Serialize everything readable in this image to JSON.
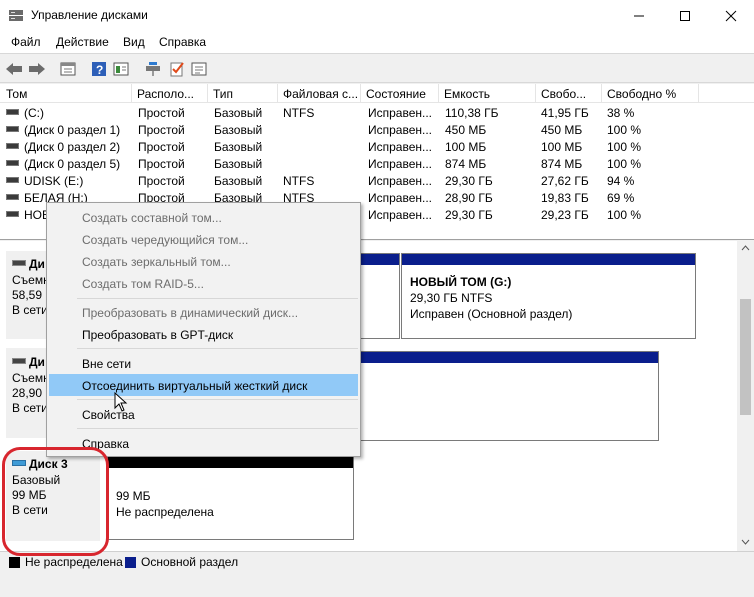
{
  "window": {
    "title": "Управление дисками"
  },
  "menu": [
    "Файл",
    "Действие",
    "Вид",
    "Справка"
  ],
  "toolbar": {
    "icons": [
      "back-icon",
      "forward-icon",
      "properties-icon",
      "help-icon",
      "view-icon",
      "connect-icon",
      "check-icon",
      "settings-icon"
    ]
  },
  "columns": [
    "Том",
    "Располо...",
    "Тип",
    "Файловая с...",
    "Состояние",
    "Емкость",
    "Свобо...",
    "Свободно %"
  ],
  "volumes": [
    [
      "(C:)",
      "Простой",
      "Базовый",
      "NTFS",
      "Исправен...",
      "110,38 ГБ",
      "41,95 ГБ",
      "38 %"
    ],
    [
      "(Диск 0 раздел 1)",
      "Простой",
      "Базовый",
      "",
      "Исправен...",
      "450 МБ",
      "450 МБ",
      "100 %"
    ],
    [
      "(Диск 0 раздел 2)",
      "Простой",
      "Базовый",
      "",
      "Исправен...",
      "100 МБ",
      "100 МБ",
      "100 %"
    ],
    [
      "(Диск 0 раздел 5)",
      "Простой",
      "Базовый",
      "",
      "Исправен...",
      "874 МБ",
      "874 МБ",
      "100 %"
    ],
    [
      "UDISK (E:)",
      "Простой",
      "Базовый",
      "NTFS",
      "Исправен...",
      "29,30 ГБ",
      "27,62 ГБ",
      "94 %"
    ],
    [
      "БЕЛАЯ (H:)",
      "Простой",
      "Базовый",
      "NTFS",
      "Исправен...",
      "28,90 ГБ",
      "19,83 ГБ",
      "69 %"
    ],
    [
      "НОВ",
      "",
      "",
      "",
      "Исправен...",
      "29,30 ГБ",
      "29,23 ГБ",
      "100 %"
    ]
  ],
  "disks": {
    "d1": {
      "name": "Ди",
      "type": "Съемн",
      "size": "58,59 Г",
      "status": "В сети"
    },
    "d1_part": {
      "name": "НОВЫЙ ТОМ  (G:)",
      "size": "29,30 ГБ NTFS",
      "status": "Исправен (Основной раздел)"
    },
    "d2": {
      "name": "Ди",
      "type": "Съемн",
      "size": "28,90 Г",
      "status": "В сети"
    },
    "d3": {
      "name": "Диск 3",
      "type": "Базовый",
      "size": "99 МБ",
      "status": "В сети"
    },
    "d3_part": {
      "size": "99 МБ",
      "status": "Не распределена"
    }
  },
  "context_menu": {
    "items": [
      {
        "label": "Создать составной том...",
        "enabled": false
      },
      {
        "label": "Создать чередующийся том...",
        "enabled": false
      },
      {
        "label": "Создать зеркальный том...",
        "enabled": false
      },
      {
        "label": "Создать том RAID-5...",
        "enabled": false
      },
      {
        "label": "Преобразовать в динамический диск...",
        "enabled": false
      },
      {
        "label": "Преобразовать в GPT-диск",
        "enabled": true
      },
      {
        "label": "Вне сети",
        "enabled": true
      },
      {
        "label": "Отсоединить виртуальный жесткий диск",
        "enabled": true,
        "highlighted": true
      },
      {
        "label": "Свойства",
        "enabled": true
      },
      {
        "label": "Справка",
        "enabled": true
      }
    ]
  },
  "legend": {
    "unallocated": "Не распределена",
    "primary": "Основной раздел"
  },
  "colors": {
    "primary_bar": "#0a1e8c",
    "unallocated_bar": "#000000",
    "highlight": "#91c9f7",
    "callout": "#d8262e"
  }
}
